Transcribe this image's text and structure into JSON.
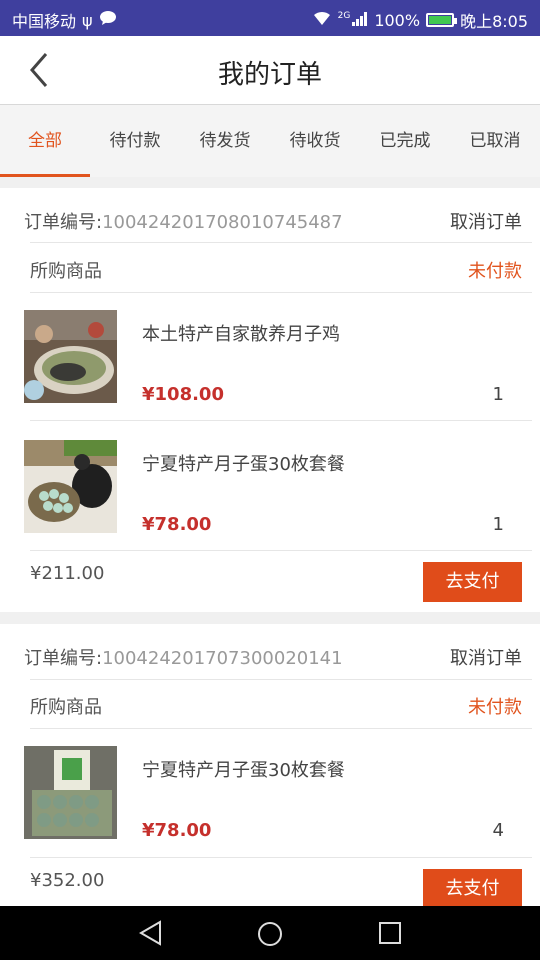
{
  "status_bar": {
    "carrier": "中国移动",
    "battery": "100%",
    "time": "晚上8:05",
    "network": "2G"
  },
  "header": {
    "title": "我的订单"
  },
  "tabs": [
    {
      "label": "全部",
      "active": true
    },
    {
      "label": "待付款",
      "active": false
    },
    {
      "label": "待发货",
      "active": false
    },
    {
      "label": "待收货",
      "active": false
    },
    {
      "label": "已完成",
      "active": false
    },
    {
      "label": "已取消",
      "active": false
    }
  ],
  "orders": [
    {
      "order_label": "订单编号:",
      "order_number": "100424201708010745487",
      "cancel_label": "取消订单",
      "goods_label": "所购商品",
      "status": "未付款",
      "items": [
        {
          "name": "本土特产自家散养月子鸡",
          "price": "¥108.00",
          "qty": "1"
        },
        {
          "name": "宁夏特产月子蛋30枚套餐",
          "price": "¥78.00",
          "qty": "1"
        }
      ],
      "total": "¥211.00",
      "pay_label": "去支付"
    },
    {
      "order_label": "订单编号:",
      "order_number": "100424201707300020141",
      "cancel_label": "取消订单",
      "goods_label": "所购商品",
      "status": "未付款",
      "items": [
        {
          "name": "宁夏特产月子蛋30枚套餐",
          "price": "¥78.00",
          "qty": "4"
        }
      ],
      "total": "¥352.00",
      "pay_label": "去支付"
    }
  ],
  "colors": {
    "accent": "#e1541e",
    "price": "#c5302c",
    "status_bar": "#3f3f9e"
  }
}
